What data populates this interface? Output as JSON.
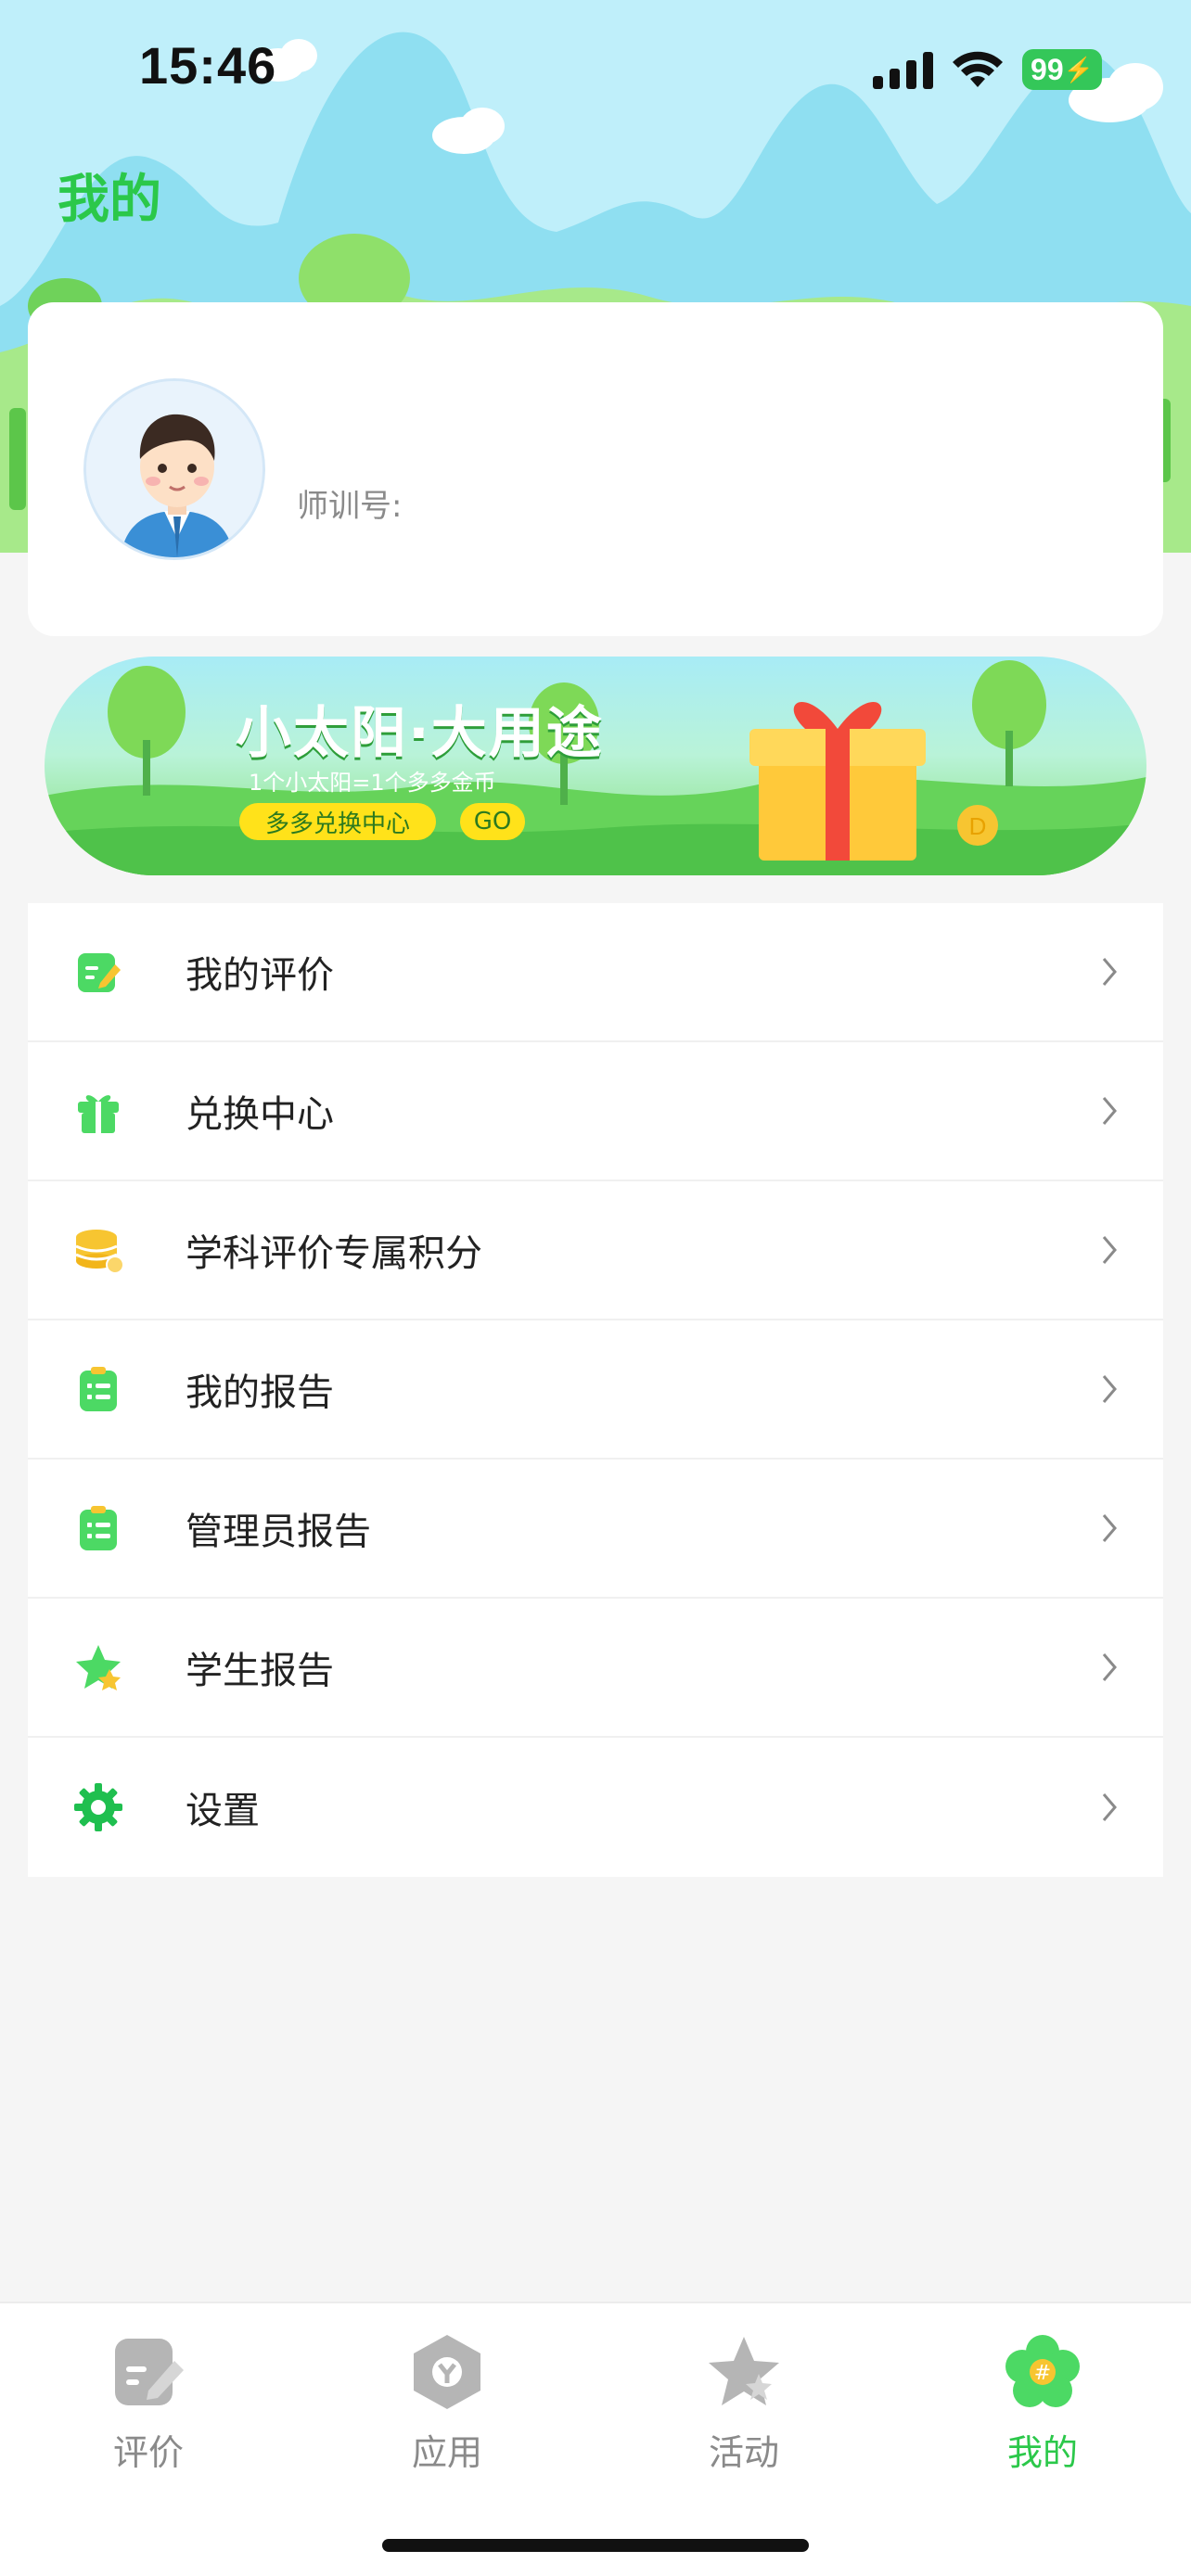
{
  "status_bar": {
    "time": "15:46",
    "battery": "99"
  },
  "header": {
    "title": "我的"
  },
  "profile": {
    "trainee_id_label": "师训号:"
  },
  "banner": {
    "title": "小太阳·大用途",
    "subtitle": "1个小太阳=1个多多金币",
    "button_label": "多多兑换中心",
    "go_label": "GO"
  },
  "menu": {
    "items": [
      {
        "label": "我的评价",
        "icon": "evaluation-icon"
      },
      {
        "label": "兑换中心",
        "icon": "gift-icon"
      },
      {
        "label": "学科评价专属积分",
        "icon": "coins-icon"
      },
      {
        "label": "我的报告",
        "icon": "report-icon"
      },
      {
        "label": "管理员报告",
        "icon": "admin-report-icon"
      },
      {
        "label": "学生报告",
        "icon": "star-icon"
      },
      {
        "label": "设置",
        "icon": "gear-icon"
      }
    ]
  },
  "tabbar": {
    "tabs": [
      {
        "label": "评价",
        "active": false
      },
      {
        "label": "应用",
        "active": false
      },
      {
        "label": "活动",
        "active": false
      },
      {
        "label": "我的",
        "active": true
      }
    ]
  },
  "colors": {
    "accent": "#2bc84a",
    "menu_icon_green": "#4cd964",
    "coin_yellow": "#f7c531",
    "inactive_tab": "#b5b5b5"
  }
}
